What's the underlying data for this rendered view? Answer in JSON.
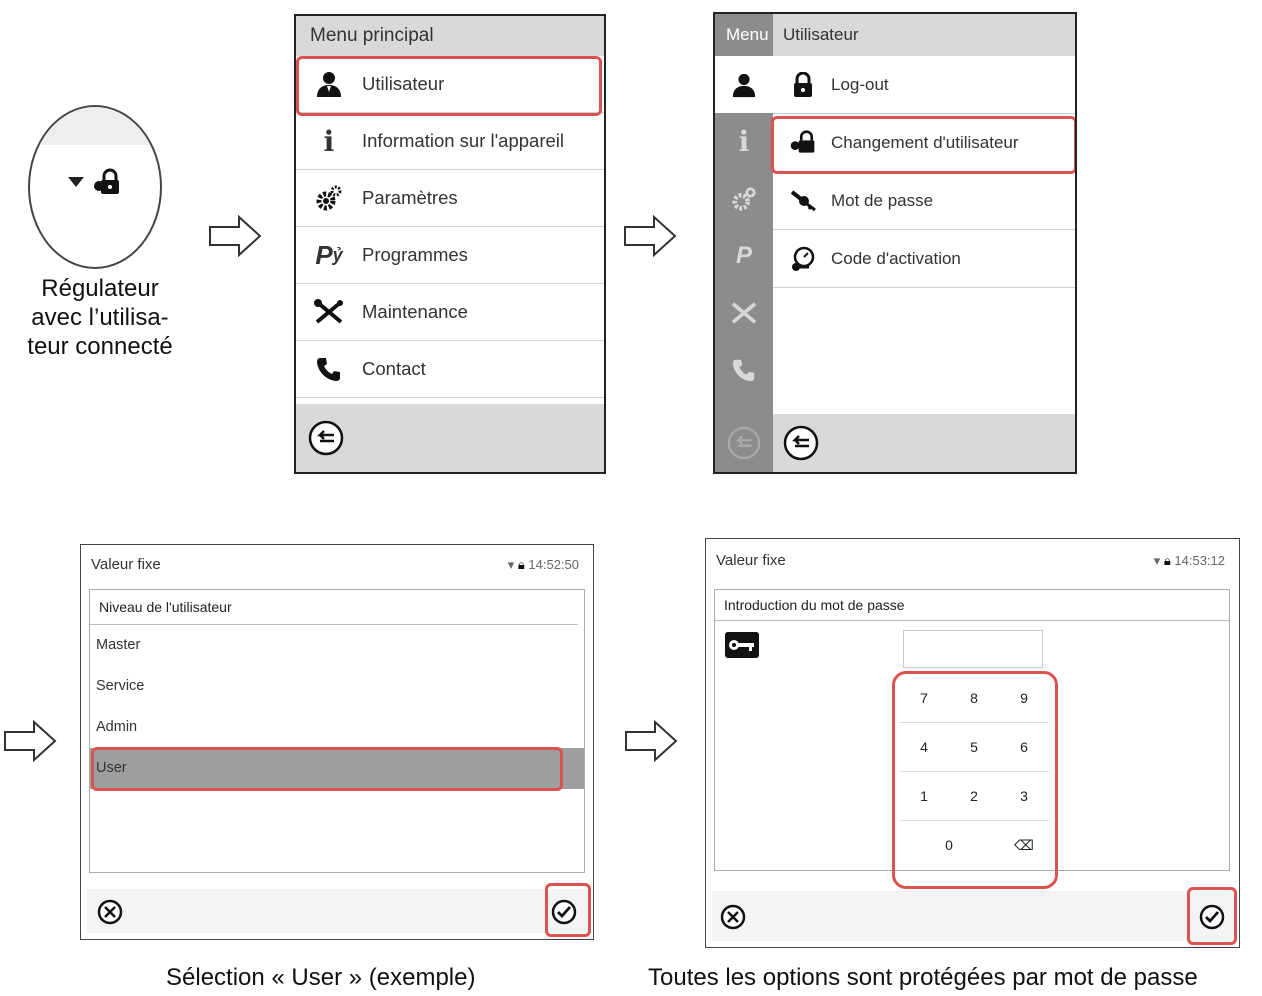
{
  "caption_left": [
    "Régulateur",
    "avec l’utilisa-",
    "teur connecté"
  ],
  "menu_principal": {
    "title": "Menu principal",
    "items": [
      {
        "label": "Utilisateur",
        "icon": "user-icon"
      },
      {
        "label": "Information sur l'appareil",
        "icon": "info-icon"
      },
      {
        "label": "Paramètres",
        "icon": "gears-icon"
      },
      {
        "label": "Programmes",
        "icon": "programs-icon"
      },
      {
        "label": "Maintenance",
        "icon": "wrench-icon"
      },
      {
        "label": "Contact",
        "icon": "phone-icon"
      }
    ]
  },
  "user_menu": {
    "sidebar_title": "Menu",
    "title": "Utilisateur",
    "items": [
      {
        "label": "Log-out",
        "icon": "lock-icon"
      },
      {
        "label": "Changement d'utilisateur",
        "icon": "user-lock-icon"
      },
      {
        "label": "Mot de passe",
        "icon": "key-icon"
      },
      {
        "label": "Code d'activation",
        "icon": "activation-code-icon"
      }
    ]
  },
  "user_level": {
    "status_title": "Valeur fixe",
    "time": "14:52:50",
    "header": "Niveau de l'utilisateur",
    "options": [
      "Master",
      "Service",
      "Admin",
      "User"
    ],
    "selected": "User"
  },
  "password_entry": {
    "status_title": "Valeur fixe",
    "time": "14:53:12",
    "header": "Introduction du mot de passe",
    "keys": [
      [
        "7",
        "8",
        "9"
      ],
      [
        "4",
        "5",
        "6"
      ],
      [
        "1",
        "2",
        "3"
      ],
      [
        "0",
        "⌫"
      ]
    ]
  },
  "captions": {
    "bottom_left": "Sélection « User » (exemple)",
    "bottom_right": "Toutes les options sont protégées par mot de passe"
  },
  "colors": {
    "highlight": "#d9534f",
    "header": "#d9d9d9",
    "sidebar": "#8c8c8c"
  }
}
